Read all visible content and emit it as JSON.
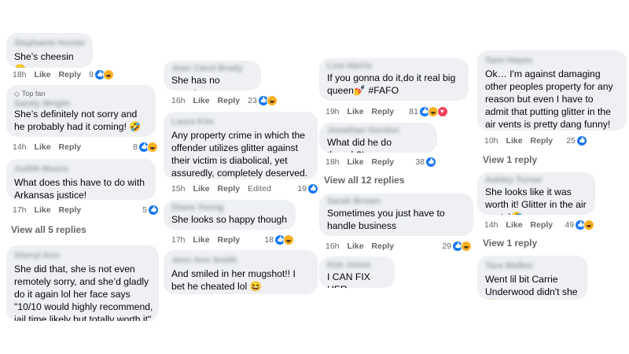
{
  "meta_labels": {
    "like": "Like",
    "reply": "Reply",
    "edited": "Edited"
  },
  "columns": [
    {
      "comments": [
        {
          "name": "Stephanie Hunter",
          "text": "She’s cheesin 🙂",
          "time": "18h",
          "count": "9",
          "reactions": [
            "like",
            "haha"
          ]
        },
        {
          "name": "Sandy Wright",
          "top_fan_label": "Top fan",
          "text": "She’s definitely not sorry and he probably had it coming! 🤣",
          "time": "14h",
          "count": "8",
          "reactions": [
            "like",
            "haha"
          ]
        },
        {
          "name": "Judith Moore",
          "text": "What does this have to do with Arkansas justice!",
          "time": "17h",
          "count": "5",
          "reactions": [
            "like"
          ]
        },
        {
          "name": "Sheryl Ann",
          "text": "She did that, she is not even remotely sorry, and she’d gladly do it again lol her face says \"10/10 would highly recommend, jail time likely but totally worth it\""
        }
      ],
      "view_more": "View all 5 replies"
    },
    {
      "comments": [
        {
          "name": "Jean Carol Brady",
          "text": "She has no regrets.",
          "time": "16h",
          "count": "23",
          "reactions": [
            "like",
            "haha"
          ]
        },
        {
          "name": "Laura Kim",
          "text": "Any property crime in which the offender utilizes glitter against their victim is diabolical, yet assuredly, completely deserved.",
          "time": "15h",
          "count": "19",
          "edited": true,
          "reactions": [
            "like"
          ]
        },
        {
          "name": "Diane Young",
          "text": "She looks so happy though",
          "time": "17h",
          "count": "18",
          "reactions": [
            "like",
            "haha"
          ]
        },
        {
          "name": "Jenn Ann Smith",
          "text": "And smiled in her mugshot!! I bet he cheated lol 😆"
        }
      ]
    },
    {
      "comments": [
        {
          "name": "Lisa Harris",
          "text": "If you gonna do it,do it real big queen💅 #FAFO",
          "time": "19h",
          "count": "81",
          "reactions": [
            "like",
            "haha",
            "love"
          ]
        },
        {
          "name": "Jonathan Gordon",
          "text": "What did he do though?!",
          "time": "18h",
          "count": "38",
          "reactions": [
            "like"
          ]
        },
        {
          "name": "Sarah Brown",
          "text": "Sometimes you just have to handle business",
          "time": "16h",
          "count": "29",
          "reactions": [
            "like",
            "haha"
          ]
        },
        {
          "name": "Kim Jones",
          "text": "I CAN FIX HER"
        }
      ],
      "view_more": "View all 12 replies"
    },
    {
      "comments": [
        {
          "name": "Tami Hayes",
          "text": "Ok… I'm against damaging other peoples property for any reason but even I have to admit that putting glitter in the air vents is pretty dang funny!",
          "time": "10h",
          "count": "25",
          "reactions": [
            "like"
          ]
        },
        {
          "name": "Ashley Turner",
          "text": "She looks like it was worth it! Glitter in the air vents!🤣",
          "time": "14h",
          "count": "49",
          "reactions": [
            "like",
            "haha"
          ]
        },
        {
          "name": "Tara Walker",
          "text": "Went lil bit Carrie Underwood didn't she😉"
        }
      ],
      "view_more": [
        "View 1 reply",
        "View 1 reply"
      ]
    }
  ]
}
